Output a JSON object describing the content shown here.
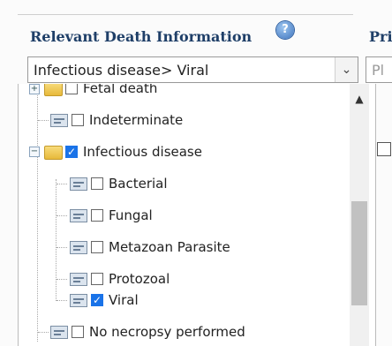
{
  "field": {
    "label": "Relevant Death Information",
    "help_icon": "?",
    "selected_value": "Infectious disease> Viral",
    "arrow": "⌄"
  },
  "right_panel": {
    "label": "Pri",
    "placeholder": "Pl"
  },
  "tree": {
    "items": [
      {
        "label": "Fetal death",
        "checked": false,
        "icon": "folder"
      },
      {
        "label": "Indeterminate",
        "checked": false,
        "icon": "document"
      },
      {
        "label": "Infectious disease",
        "checked": true,
        "icon": "folder-open"
      },
      {
        "label": "Bacterial",
        "checked": false,
        "icon": "document"
      },
      {
        "label": "Fungal",
        "checked": false,
        "icon": "document"
      },
      {
        "label": "Metazoan Parasite",
        "checked": false,
        "icon": "document"
      },
      {
        "label": "Protozoal",
        "checked": false,
        "icon": "document"
      },
      {
        "label": "Viral",
        "checked": true,
        "icon": "document"
      },
      {
        "label": "No necropsy performed",
        "checked": false,
        "icon": "document"
      }
    ],
    "scroll_up": "▲"
  },
  "colors": {
    "label": "#1f3f68",
    "check": "#1a73e8"
  }
}
